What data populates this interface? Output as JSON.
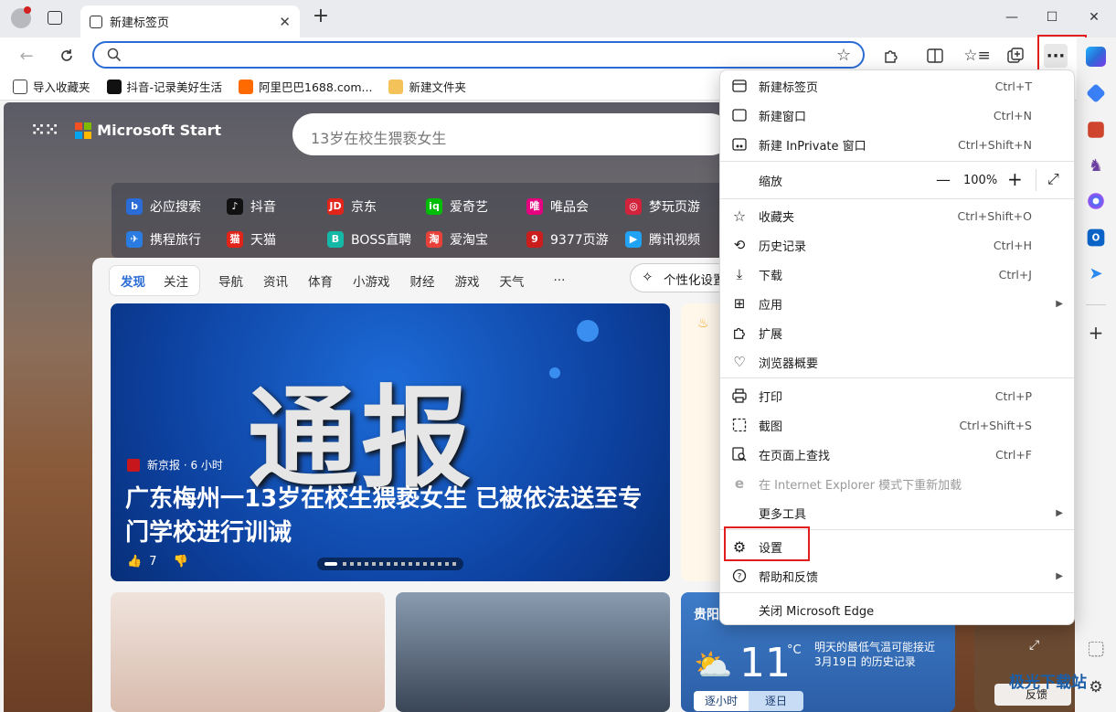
{
  "browser": {
    "tab_title": "新建标签页",
    "address_value": "",
    "favorites": [
      "导入收藏夹",
      "抖音-记录美好生活",
      "阿里巴巴1688.com...",
      "新建文件夹"
    ]
  },
  "page": {
    "brand": "Microsoft Start",
    "search_text": "13岁在校生猥亵女生",
    "sites_row1": [
      "必应搜索",
      "抖音",
      "京东",
      "爱奇艺",
      "唯品会",
      "梦玩页游"
    ],
    "sites_row2": [
      "携程旅行",
      "天猫",
      "BOSS直聘",
      "爱淘宝",
      "9377页游",
      "腾讯视频"
    ],
    "feed_tabs": [
      "发现",
      "关注"
    ],
    "feed_nav": [
      "导航",
      "资讯",
      "体育",
      "小游戏",
      "财经",
      "游戏",
      "天气",
      "···"
    ],
    "customize": "个性化设置",
    "hero_big": "通报",
    "hero_source": "新京报 · 6 小时",
    "hero_title": "广东梅州一13岁在校生猥亵女生 已被依法送至专门学校进行训诫",
    "hero_likes": "7",
    "weather": {
      "city": "贵阳",
      "temp": "11",
      "unit": "°C",
      "note": "明天的最低气温可能接近 3月19日 的历史记录",
      "btn_hourly": "逐小时",
      "btn_daily": "逐日"
    },
    "feedback": "反馈"
  },
  "menu": {
    "items": [
      {
        "label": "新建标签页",
        "shortcut": "Ctrl+T",
        "icon": "new-tab-icon"
      },
      {
        "label": "新建窗口",
        "shortcut": "Ctrl+N",
        "icon": "new-window-icon"
      },
      {
        "label": "新建 InPrivate 窗口",
        "shortcut": "Ctrl+Shift+N",
        "icon": "inprivate-icon"
      },
      {
        "label": "缩放",
        "zoom": "100%",
        "icon": ""
      },
      {
        "label": "收藏夹",
        "shortcut": "Ctrl+Shift+O",
        "icon": "star-icon"
      },
      {
        "label": "历史记录",
        "shortcut": "Ctrl+H",
        "icon": "history-icon"
      },
      {
        "label": "下载",
        "shortcut": "Ctrl+J",
        "icon": "download-icon"
      },
      {
        "label": "应用",
        "shortcut": "",
        "icon": "apps-icon"
      },
      {
        "label": "扩展",
        "shortcut": "",
        "icon": "extensions-icon"
      },
      {
        "label": "浏览器概要",
        "shortcut": "",
        "icon": "heartbeat-icon"
      },
      {
        "label": "打印",
        "shortcut": "Ctrl+P",
        "icon": "print-icon"
      },
      {
        "label": "截图",
        "shortcut": "Ctrl+Shift+S",
        "icon": "screenshot-icon"
      },
      {
        "label": "在页面上查找",
        "shortcut": "Ctrl+F",
        "icon": "find-icon"
      },
      {
        "label": "在 Internet Explorer 模式下重新加载",
        "shortcut": "",
        "icon": "ie-icon"
      },
      {
        "label": "更多工具",
        "shortcut": "",
        "icon": ""
      },
      {
        "label": "设置",
        "shortcut": "",
        "icon": "gear-icon"
      },
      {
        "label": "帮助和反馈",
        "shortcut": "",
        "icon": "help-icon"
      },
      {
        "label": "关闭 Microsoft Edge",
        "shortcut": "",
        "icon": ""
      }
    ]
  },
  "watermark": "极光下载站"
}
